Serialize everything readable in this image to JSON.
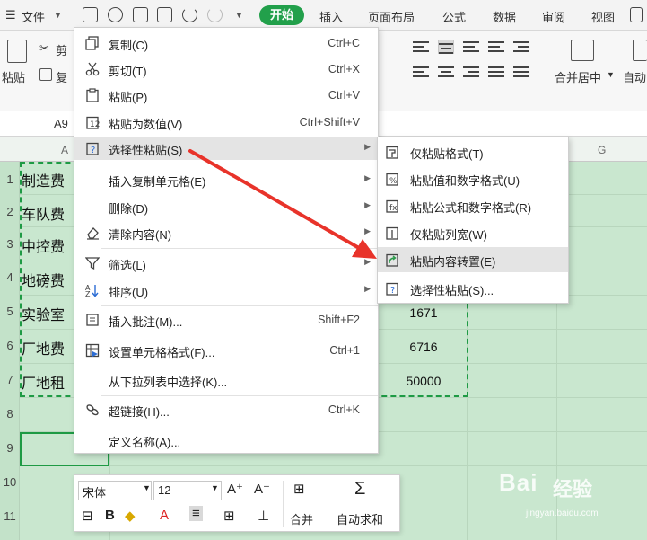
{
  "menubar": {
    "file": "文件",
    "tabs": [
      "开始",
      "插入",
      "页面布局",
      "公式",
      "数据",
      "审阅",
      "视图"
    ]
  },
  "ribbon": {
    "paste": "粘贴",
    "cut": "剪",
    "copy": "复",
    "merge_center": "合并居中",
    "autowrap": "自动"
  },
  "formula_bar": {
    "name_box": "A9"
  },
  "columns": [
    "A",
    "G"
  ],
  "rows": [
    "1",
    "2",
    "3",
    "4",
    "5",
    "6",
    "7",
    "8",
    "9",
    "10",
    "11"
  ],
  "cells_col_a": [
    "制造费",
    "车队费",
    "中控费",
    "地磅费",
    "实验室",
    "厂地费",
    "厂地租"
  ],
  "cells_col_d": [
    "1671",
    "6716",
    "50000"
  ],
  "context_menu": {
    "items": [
      {
        "label": "复制(C)",
        "shortcut": "Ctrl+C",
        "icon": "copy-icon"
      },
      {
        "label": "剪切(T)",
        "shortcut": "Ctrl+X",
        "icon": "scissors-icon"
      },
      {
        "label": "粘贴(P)",
        "shortcut": "Ctrl+V",
        "icon": "clipboard-icon"
      },
      {
        "label": "粘贴为数值(V)",
        "shortcut": "Ctrl+Shift+V",
        "icon": "paste-value-icon"
      },
      {
        "label": "选择性粘贴(S)",
        "shortcut": "",
        "icon": "paste-special-icon",
        "submenu": true,
        "highlighted": true
      },
      {
        "label": "插入复制单元格(E)",
        "shortcut": "",
        "submenu": true
      },
      {
        "label": "删除(D)",
        "shortcut": "",
        "submenu": true
      },
      {
        "label": "清除内容(N)",
        "shortcut": "",
        "icon": "eraser-icon",
        "submenu": true
      },
      {
        "label": "筛选(L)",
        "shortcut": "",
        "icon": "filter-icon",
        "submenu": true
      },
      {
        "label": "排序(U)",
        "shortcut": "",
        "icon": "sort-icon",
        "submenu": true
      },
      {
        "label": "插入批注(M)...",
        "shortcut": "Shift+F2",
        "icon": "comment-icon"
      },
      {
        "label": "设置单元格格式(F)...",
        "shortcut": "Ctrl+1",
        "icon": "format-cell-icon"
      },
      {
        "label": "从下拉列表中选择(K)...",
        "shortcut": ""
      },
      {
        "label": "超链接(H)...",
        "shortcut": "Ctrl+K",
        "icon": "link-icon"
      },
      {
        "label": "定义名称(A)...",
        "shortcut": ""
      }
    ]
  },
  "submenu": {
    "items": [
      {
        "label": "仅粘贴格式(T)"
      },
      {
        "label": "粘贴值和数字格式(U)"
      },
      {
        "label": "粘贴公式和数字格式(R)"
      },
      {
        "label": "仅粘贴列宽(W)"
      },
      {
        "label": "粘贴内容转置(E)",
        "highlighted": true
      },
      {
        "label": "选择性粘贴(S)..."
      }
    ]
  },
  "mini_toolbar": {
    "font": "宋体",
    "size": "12",
    "merge": "合并",
    "autosum": "自动求和"
  },
  "watermark": {
    "brand": "Bai",
    "brand2": "经验",
    "url": "jingyan.baidu.com"
  },
  "colors": {
    "accent": "#22a04b",
    "arrow": "#e8332a",
    "grid": "#c9e7cf"
  }
}
